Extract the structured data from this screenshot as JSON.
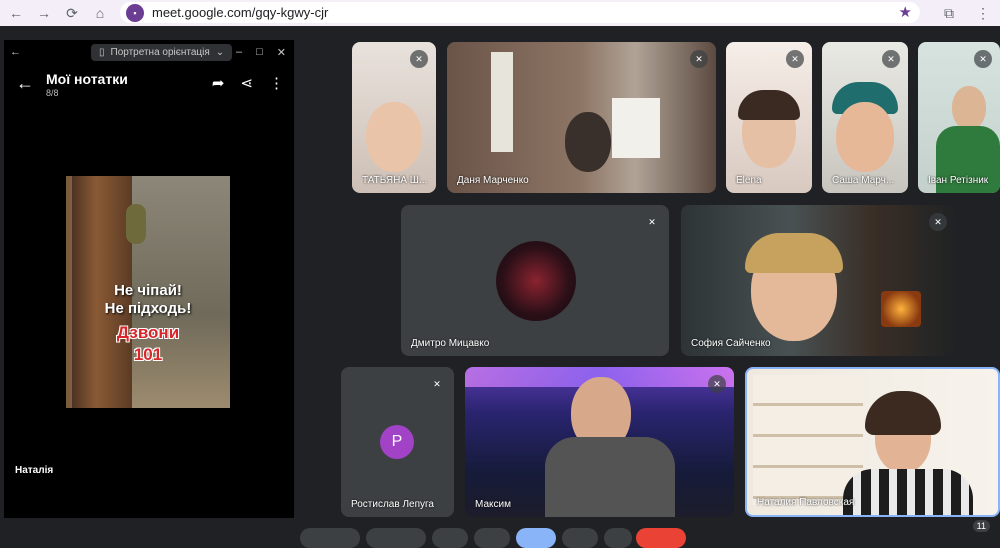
{
  "browser": {
    "url": "meet.google.com/gqy-kgwy-cjr",
    "back_icon": "←",
    "forward_icon": "→",
    "reload_icon": "⟳",
    "home_icon": "⌂",
    "star_icon": "★",
    "extensions_icon": "⧉",
    "menu_icon": "⋮"
  },
  "phone": {
    "back_small": "←",
    "orientation_label": "Портретна орієнтація",
    "orientation_chevron": "⌄",
    "minimize": "–",
    "maximize": "□",
    "close": "✕",
    "notes_back": "←",
    "notes_title": "Мої нотатки",
    "notes_count": "8/8",
    "share_forward": "➦",
    "share": "⋖",
    "more": "⋮",
    "poster_line1": "Не чіпай!",
    "poster_line2": "Не підходь!",
    "poster_line3": "Дзвони",
    "poster_line4": "101",
    "owner": "Наталія"
  },
  "participants": {
    "p1": "ТАТЬЯНА Ш...",
    "p2": "Даня Марченко",
    "p3": "Elena",
    "p4": "Саша Марч...",
    "p5": "Іван Ретізник",
    "p6": "Дмитро Мицавко",
    "p7": "София Сайченко",
    "p8": "Ростислав Лепуга",
    "p8_initial": "P",
    "p9": "Максим",
    "p10": "Наталия Павловская"
  },
  "mic_off_icon": "🎙",
  "participant_count": "11",
  "colors": {
    "avatar_purple": "#a142c7",
    "active_speaker_border": "#8ab4f8",
    "browser_accent": "#6b3d93"
  }
}
